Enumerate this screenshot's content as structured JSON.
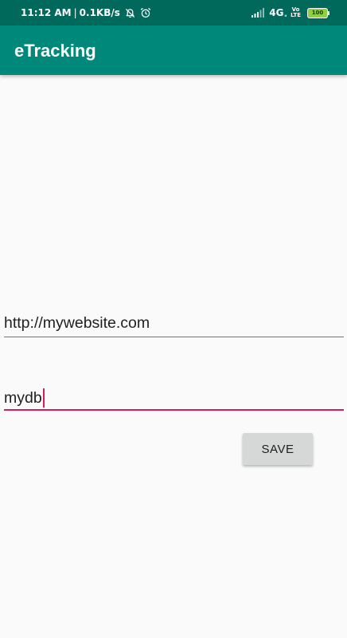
{
  "status_bar": {
    "time": "11:12 AM",
    "separator": "|",
    "net_speed": "0.1KB/s",
    "icons": [
      "bell-muted-icon",
      "alarm-clock-icon",
      "signal-bars-icon"
    ],
    "network_type": "4G",
    "network_sub": "ᵢₗ",
    "volte_top": "Vo",
    "volte_bottom": "LTE",
    "battery_level": "100",
    "colors": {
      "status_bar_bg": "#00695c",
      "battery_fill": "#8bd33b"
    }
  },
  "app_bar": {
    "title": "eTracking",
    "color": "#00897b"
  },
  "form": {
    "url_field": {
      "value": "http://mywebsite.com",
      "underline_color": "#757575"
    },
    "db_field": {
      "value": "mydb",
      "focused": true,
      "accent_color": "#d81b60"
    },
    "save_button": {
      "label": "SAVE"
    }
  }
}
